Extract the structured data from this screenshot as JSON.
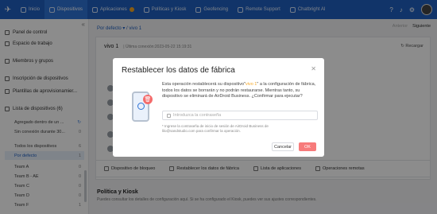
{
  "nav": {
    "items": [
      {
        "label": "Inicio",
        "active": false
      },
      {
        "label": "Dispositivos",
        "active": true
      },
      {
        "label": "Aplicaciones",
        "active": false
      },
      {
        "label": "Políticas y Kiosk",
        "active": false
      },
      {
        "label": "Geofencing",
        "active": false
      },
      {
        "label": "Remote Support",
        "active": false
      },
      {
        "label": "Chatbright AI",
        "active": false
      }
    ],
    "accent": "#1f5fbf"
  },
  "sidebar": {
    "panel": "Panel de control",
    "workspace": "Espacio de trabajo",
    "members": "Miembros y grupos",
    "enroll": "Inscripción de dispositivos",
    "templates": "Plantillas de aprovisionamier...",
    "list_title": "Lista de dispositivos (6)",
    "groups": [
      {
        "label": "Agregado dentro de un ...",
        "count": ""
      },
      {
        "label": "Sin conexión durante 30...",
        "count": "0"
      },
      {
        "label": "Todos los dispositivos",
        "count": "6"
      },
      {
        "label": "Por defecto",
        "count": "1"
      },
      {
        "label": "Team A",
        "count": "0"
      },
      {
        "label": "Team B - AE",
        "count": "0"
      },
      {
        "label": "Team C",
        "count": "0"
      },
      {
        "label": "Team D",
        "count": "0"
      },
      {
        "label": "Team F",
        "count": "1"
      }
    ]
  },
  "main": {
    "crumb1": "Por defecto",
    "crumb2": "vivo 1",
    "prev": "Anterior",
    "next": "Siguiente",
    "device_name": "vivo 1",
    "device_info": "| Última conexión:2023-05-22 15:19:31",
    "refresh": "Recargar",
    "actions": [
      "Dispositivo de bloqueo",
      "Restablecer los datos de fábrica",
      "Lista de aplicaciones",
      "Operaciones remotas"
    ],
    "policy_title": "Política y Kiosk",
    "policy_text": "Puedes consultar los detalles de configuración aquí. Si se ha configurado el Kiosk, puedes ver sus ajustes correspondientes."
  },
  "modal": {
    "title": "Restablecer los datos de fábrica",
    "body_pre": "Esta operación restablecerá su dispositivo\"",
    "body_device": "vivo 1",
    "body_post": "\" a la configuración de fábrica, todos los datos se borrarán y no podrán restaurarse. Mientras tanto, su dispositivo se eliminará de AirDroid Business. ¿Confirmar para ejecutar?",
    "password_placeholder": "Introduzca la contraseña",
    "hint": "* Ingrese la contraseña de inicio de sesión de AirDroid Business de lilo@sandstudio.com para confirmar la operación.",
    "cancel": "Cancelar",
    "ok": "OK"
  }
}
